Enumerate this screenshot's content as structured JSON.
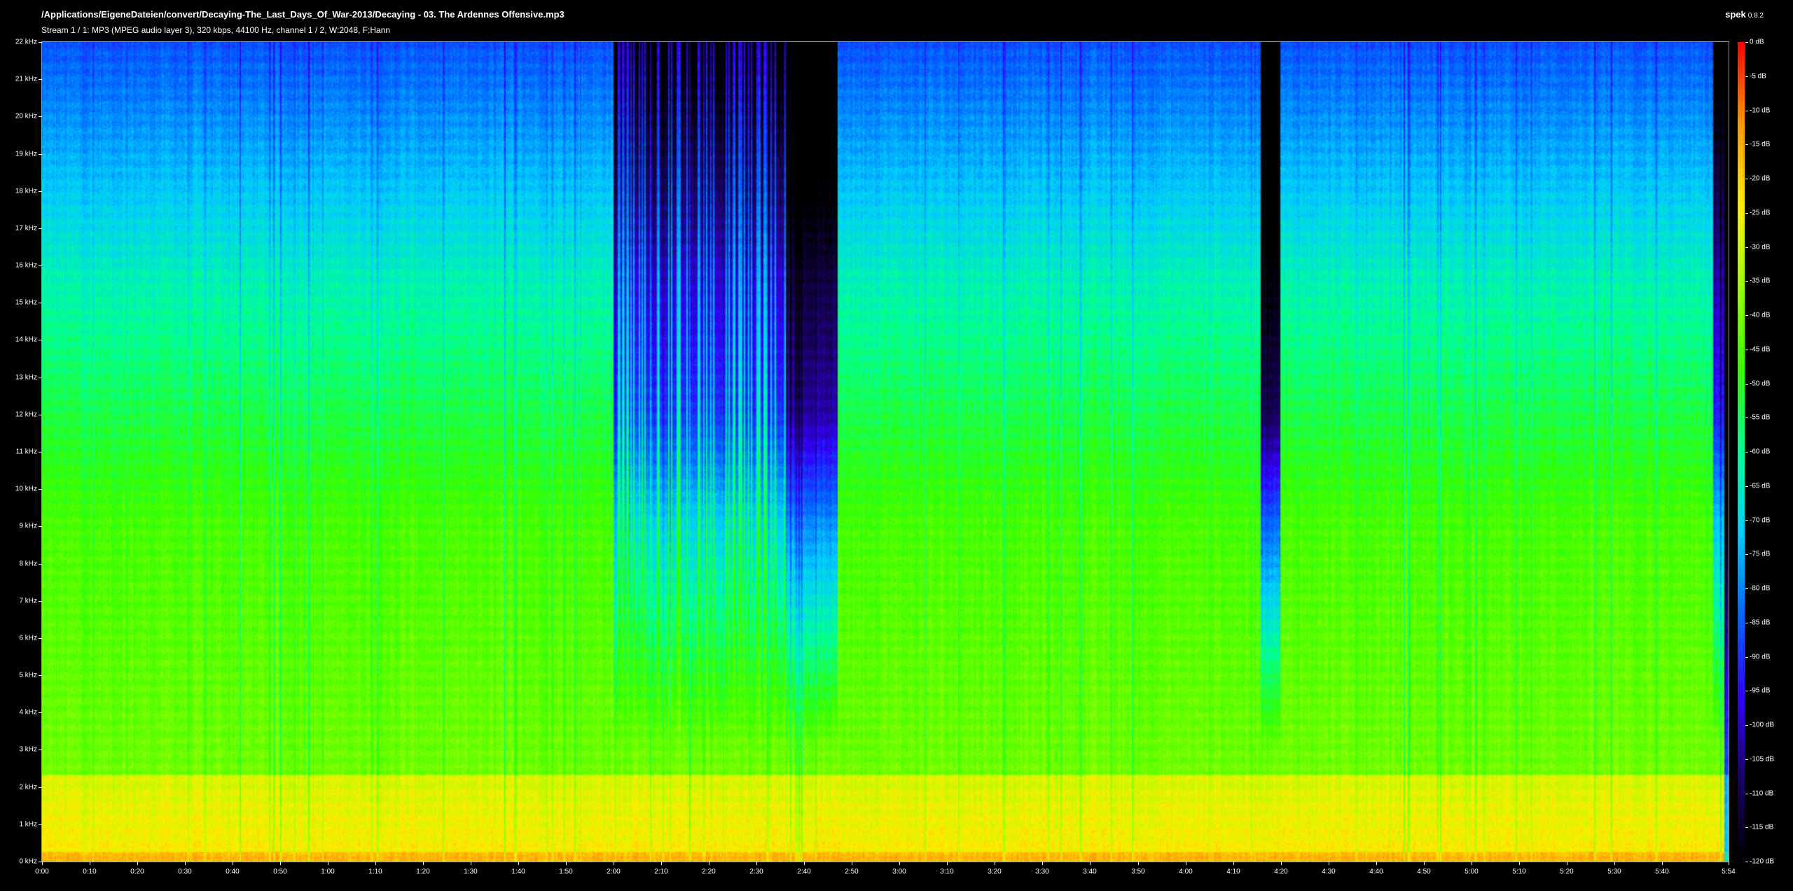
{
  "window": {
    "file_path": "/Applications/EigeneDateien/convert/Decaying-The_Last_Days_Of_War-2013/Decaying - 03. The Ardennes Offensive.mp3",
    "stream_info": "Stream 1 / 1: MP3 (MPEG audio layer 3), 320 kbps, 44100 Hz, channel 1 / 2, W:2048, F:Hann",
    "app_name": "spek",
    "app_version": "0.8.2"
  },
  "chart_data": {
    "type": "heatmap",
    "x_axis": {
      "range_seconds": [
        0,
        354
      ],
      "ticks": [
        {
          "t": 0,
          "label": "0:00"
        },
        {
          "t": 10,
          "label": "0:10"
        },
        {
          "t": 20,
          "label": "0:20"
        },
        {
          "t": 30,
          "label": "0:30"
        },
        {
          "t": 40,
          "label": "0:40"
        },
        {
          "t": 50,
          "label": "0:50"
        },
        {
          "t": 60,
          "label": "1:00"
        },
        {
          "t": 70,
          "label": "1:10"
        },
        {
          "t": 80,
          "label": "1:20"
        },
        {
          "t": 90,
          "label": "1:30"
        },
        {
          "t": 100,
          "label": "1:40"
        },
        {
          "t": 110,
          "label": "1:50"
        },
        {
          "t": 120,
          "label": "2:00"
        },
        {
          "t": 130,
          "label": "2:10"
        },
        {
          "t": 140,
          "label": "2:20"
        },
        {
          "t": 150,
          "label": "2:30"
        },
        {
          "t": 160,
          "label": "2:40"
        },
        {
          "t": 170,
          "label": "2:50"
        },
        {
          "t": 180,
          "label": "3:00"
        },
        {
          "t": 190,
          "label": "3:10"
        },
        {
          "t": 200,
          "label": "3:20"
        },
        {
          "t": 210,
          "label": "3:30"
        },
        {
          "t": 220,
          "label": "3:40"
        },
        {
          "t": 230,
          "label": "3:50"
        },
        {
          "t": 240,
          "label": "4:00"
        },
        {
          "t": 250,
          "label": "4:10"
        },
        {
          "t": 260,
          "label": "4:20"
        },
        {
          "t": 270,
          "label": "4:30"
        },
        {
          "t": 280,
          "label": "4:40"
        },
        {
          "t": 290,
          "label": "4:50"
        },
        {
          "t": 300,
          "label": "5:00"
        },
        {
          "t": 310,
          "label": "5:10"
        },
        {
          "t": 320,
          "label": "5:20"
        },
        {
          "t": 330,
          "label": "5:30"
        },
        {
          "t": 340,
          "label": "5:40"
        },
        {
          "t": 354,
          "label": "5:54"
        }
      ]
    },
    "y_axis": {
      "range_khz": [
        0,
        22
      ],
      "ticks": [
        {
          "f": 0,
          "label": "0 kHz"
        },
        {
          "f": 1,
          "label": "1 kHz"
        },
        {
          "f": 2,
          "label": "2 kHz"
        },
        {
          "f": 3,
          "label": "3 kHz"
        },
        {
          "f": 4,
          "label": "4 kHz"
        },
        {
          "f": 5,
          "label": "5 kHz"
        },
        {
          "f": 6,
          "label": "6 kHz"
        },
        {
          "f": 7,
          "label": "7 kHz"
        },
        {
          "f": 8,
          "label": "8 kHz"
        },
        {
          "f": 9,
          "label": "9 kHz"
        },
        {
          "f": 10,
          "label": "10 kHz"
        },
        {
          "f": 11,
          "label": "11 kHz"
        },
        {
          "f": 12,
          "label": "12 kHz"
        },
        {
          "f": 13,
          "label": "13 kHz"
        },
        {
          "f": 14,
          "label": "14 kHz"
        },
        {
          "f": 15,
          "label": "15 kHz"
        },
        {
          "f": 16,
          "label": "16 kHz"
        },
        {
          "f": 17,
          "label": "17 kHz"
        },
        {
          "f": 18,
          "label": "18 kHz"
        },
        {
          "f": 19,
          "label": "19 kHz"
        },
        {
          "f": 20,
          "label": "20 kHz"
        },
        {
          "f": 21,
          "label": "21 kHz"
        },
        {
          "f": 22,
          "label": "22 kHz"
        }
      ]
    },
    "colorbar": {
      "range_db": [
        -120,
        0
      ],
      "colors_low_to_high": [
        "#000000",
        "#1a0066",
        "#3300ff",
        "#0066ff",
        "#00ccff",
        "#00ff99",
        "#33ff00",
        "#99ff00",
        "#ffee00",
        "#ff9900",
        "#ff0000"
      ],
      "ticks": [
        {
          "db": 0,
          "label": "0 dB"
        },
        {
          "db": -5,
          "label": "-5 dB"
        },
        {
          "db": -10,
          "label": "-10 dB"
        },
        {
          "db": -15,
          "label": "-15 dB"
        },
        {
          "db": -20,
          "label": "-20 dB"
        },
        {
          "db": -25,
          "label": "-25 dB"
        },
        {
          "db": -30,
          "label": "-30 dB"
        },
        {
          "db": -35,
          "label": "-35 dB"
        },
        {
          "db": -40,
          "label": "-40 dB"
        },
        {
          "db": -45,
          "label": "-45 dB"
        },
        {
          "db": -50,
          "label": "-50 dB"
        },
        {
          "db": -55,
          "label": "-55 dB"
        },
        {
          "db": -60,
          "label": "-60 dB"
        },
        {
          "db": -65,
          "label": "-65 dB"
        },
        {
          "db": -70,
          "label": "-70 dB"
        },
        {
          "db": -75,
          "label": "-75 dB"
        },
        {
          "db": -80,
          "label": "-80 dB"
        },
        {
          "db": -85,
          "label": "-85 dB"
        },
        {
          "db": -90,
          "label": "-90 dB"
        },
        {
          "db": -95,
          "label": "-95 dB"
        },
        {
          "db": -100,
          "label": "-100 dB"
        },
        {
          "db": -105,
          "label": "-105 dB"
        },
        {
          "db": -110,
          "label": "-110 dB"
        },
        {
          "db": -115,
          "label": "-115 dB"
        },
        {
          "db": -120,
          "label": "-120 dB"
        }
      ]
    },
    "quiet_sections_seconds": [
      [
        120,
        156
      ],
      [
        156,
        167
      ],
      [
        256,
        260
      ]
    ]
  }
}
